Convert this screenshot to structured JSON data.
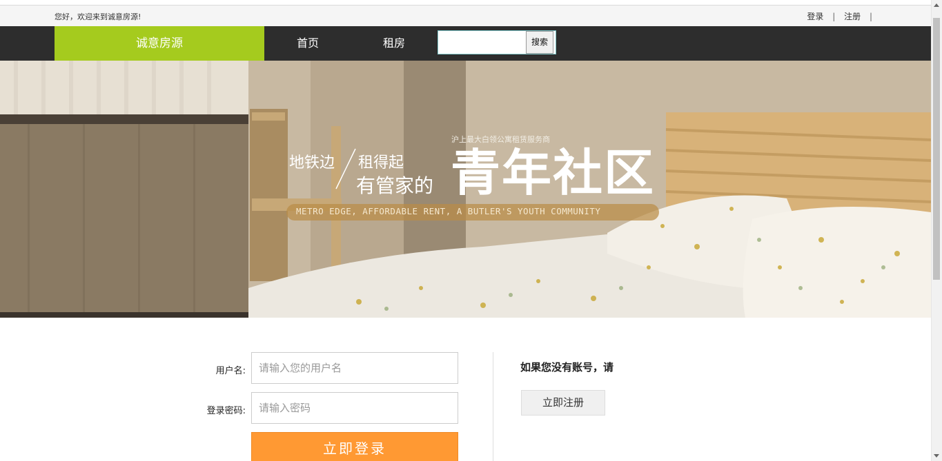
{
  "topbar": {
    "welcome": "您好，欢迎来到诚意房源!",
    "login_link": "登录",
    "register_link": "注册",
    "separator": "|"
  },
  "navbar": {
    "brand": "诚意房源",
    "items": [
      {
        "label": "首页"
      },
      {
        "label": "租房"
      }
    ],
    "search": {
      "placeholder": "",
      "button": "搜索"
    }
  },
  "hero": {
    "subtitle": "沪上最大白领公寓租赁服务商",
    "line1_left": "地铁边",
    "line1_right": "租得起",
    "line2": "有管家的",
    "headline": "青年社区",
    "english": "METRO EDGE, AFFORDABLE RENT, A BUTLER'S YOUTH COMMUNITY"
  },
  "login": {
    "username_label": "用户名:",
    "username_placeholder": "请输入您的用户名",
    "password_label": "登录密码:",
    "password_placeholder": "请输入密码",
    "submit": "立即登录"
  },
  "register": {
    "prompt": "如果您没有账号，请",
    "button": "立即注册"
  },
  "colors": {
    "brand_green": "#a5cb1e",
    "nav_dark": "#2d2d2d",
    "login_orange": "#ff9933"
  }
}
